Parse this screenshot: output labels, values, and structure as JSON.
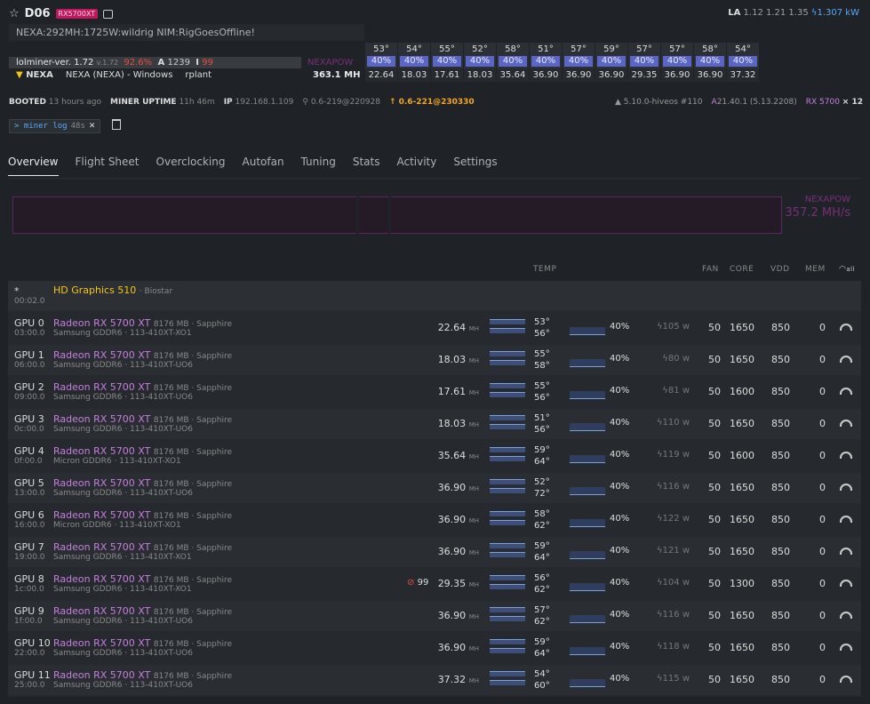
{
  "rig": {
    "name": "D06",
    "badge": "RX5700XT"
  },
  "load_average": {
    "label": "LA",
    "values": "1.12 1.21 1.35",
    "power": "1.307 kW"
  },
  "miner_message": "NEXA:292MH:1725W:wildrig NIM:RigGoesOffline!",
  "miner": {
    "name": "lolminer-ver. 1.72",
    "version": "v.1.72",
    "accept_pct": "92.6%",
    "accepted_label": "A",
    "accepted": "1239",
    "rejected_label": "I",
    "rejected": "99"
  },
  "coin": {
    "symbol": "NEXA",
    "wallet": "NEXA (NEXA) - Windows",
    "pool": "rplant"
  },
  "algo": "NEXAPOW",
  "hashrate": "363.1 MH",
  "gpu_tiles": [
    {
      "temp": "53°",
      "fan": "40%",
      "hr": "22.64"
    },
    {
      "temp": "54°",
      "fan": "40%",
      "hr": "18.03"
    },
    {
      "temp": "55°",
      "fan": "40%",
      "hr": "17.61"
    },
    {
      "temp": "52°",
      "fan": "40%",
      "hr": "18.03"
    },
    {
      "temp": "58°",
      "fan": "40%",
      "hr": "35.64"
    },
    {
      "temp": "51°",
      "fan": "40%",
      "hr": "36.90"
    },
    {
      "temp": "57°",
      "fan": "40%",
      "hr": "36.90"
    },
    {
      "temp": "59°",
      "fan": "40%",
      "hr": "36.90"
    },
    {
      "temp": "57°",
      "fan": "40%",
      "hr": "29.35"
    },
    {
      "temp": "57°",
      "fan": "40%",
      "hr": "36.90"
    },
    {
      "temp": "58°",
      "fan": "40%",
      "hr": "36.90"
    },
    {
      "temp": "54°",
      "fan": "40%",
      "hr": "37.32"
    }
  ],
  "info": {
    "booted_label": "BOOTED",
    "booted": "13 hours ago",
    "uptime_label": "MINER UPTIME",
    "uptime": "11h 46m",
    "ip_label": "IP",
    "ip": "192.168.1.109",
    "agent": "0.6-219@220928",
    "update": "0.6-221@230330",
    "kernel": "5.10.0-hiveos #110",
    "driver": "21.40.1 (5.13.2208)",
    "gpu_model": "RX 5700",
    "gpu_count": "× 12"
  },
  "log_button": {
    "label": "> miner log",
    "age": "48s"
  },
  "tabs": [
    "Overview",
    "Flight Sheet",
    "Overclocking",
    "Autofan",
    "Tuning",
    "Stats",
    "Activity",
    "Settings"
  ],
  "graph": {
    "algo": "NEXAPOW",
    "hashrate": "357.2 MH/s"
  },
  "table_headers": {
    "temp": "TEMP",
    "fan": "FAN",
    "core": "CORE",
    "vdd": "VDD",
    "mem": "MEM",
    "all": "all"
  },
  "cpu": {
    "id": "*",
    "bus": "00:02.0",
    "name": "HD Graphics 510",
    "vendor": "· Biostar"
  },
  "gpus": [
    {
      "id": "GPU 0",
      "bus": "03:00.0",
      "name": "Radeon RX 5700 XT",
      "sub": "8176 MB · Sapphire",
      "mem": "Samsung GDDR6 · 113-410XT-XO1",
      "hr": "22.64",
      "t1": "53°",
      "t2": "56°",
      "fan": "40%",
      "pw": "105",
      "fanv": "50",
      "core": "1650",
      "vdd": "850",
      "memv": "0",
      "rej": ""
    },
    {
      "id": "GPU 1",
      "bus": "06:00.0",
      "name": "Radeon RX 5700 XT",
      "sub": "8176 MB · Sapphire",
      "mem": "Samsung GDDR6 · 113-410XT-UO6",
      "hr": "18.03",
      "t1": "55°",
      "t2": "58°",
      "fan": "40%",
      "pw": "80",
      "fanv": "50",
      "core": "1650",
      "vdd": "850",
      "memv": "0",
      "rej": ""
    },
    {
      "id": "GPU 2",
      "bus": "09:00.0",
      "name": "Radeon RX 5700 XT",
      "sub": "8176 MB · Sapphire",
      "mem": "Samsung GDDR6 · 113-410XT-UO6",
      "hr": "17.61",
      "t1": "55°",
      "t2": "56°",
      "fan": "40%",
      "pw": "81",
      "fanv": "50",
      "core": "1600",
      "vdd": "850",
      "memv": "0",
      "rej": ""
    },
    {
      "id": "GPU 3",
      "bus": "0c:00.0",
      "name": "Radeon RX 5700 XT",
      "sub": "8176 MB · Sapphire",
      "mem": "Samsung GDDR6 · 113-410XT-UO6",
      "hr": "18.03",
      "t1": "51°",
      "t2": "56°",
      "fan": "40%",
      "pw": "110",
      "fanv": "50",
      "core": "1650",
      "vdd": "850",
      "memv": "0",
      "rej": ""
    },
    {
      "id": "GPU 4",
      "bus": "0f:00.0",
      "name": "Radeon RX 5700 XT",
      "sub": "8176 MB · Sapphire",
      "mem": "Micron GDDR6 · 113-410XT-XO1",
      "hr": "35.64",
      "t1": "59°",
      "t2": "64°",
      "fan": "40%",
      "pw": "119",
      "fanv": "50",
      "core": "1600",
      "vdd": "850",
      "memv": "0",
      "rej": ""
    },
    {
      "id": "GPU 5",
      "bus": "13:00.0",
      "name": "Radeon RX 5700 XT",
      "sub": "8176 MB · Sapphire",
      "mem": "Samsung GDDR6 · 113-410XT-UO6",
      "hr": "36.90",
      "t1": "52°",
      "t2": "72°",
      "fan": "40%",
      "pw": "116",
      "fanv": "50",
      "core": "1650",
      "vdd": "850",
      "memv": "0",
      "rej": ""
    },
    {
      "id": "GPU 6",
      "bus": "16:00.0",
      "name": "Radeon RX 5700 XT",
      "sub": "8176 MB · Sapphire",
      "mem": "Micron GDDR6 · 113-410XT-XO1",
      "hr": "36.90",
      "t1": "58°",
      "t2": "62°",
      "fan": "40%",
      "pw": "122",
      "fanv": "50",
      "core": "1650",
      "vdd": "850",
      "memv": "0",
      "rej": ""
    },
    {
      "id": "GPU 7",
      "bus": "19:00.0",
      "name": "Radeon RX 5700 XT",
      "sub": "8176 MB · Sapphire",
      "mem": "Samsung GDDR6 · 113-410XT-XO1",
      "hr": "36.90",
      "t1": "59°",
      "t2": "64°",
      "fan": "40%",
      "pw": "121",
      "fanv": "50",
      "core": "1650",
      "vdd": "850",
      "memv": "0",
      "rej": ""
    },
    {
      "id": "GPU 8",
      "bus": "1c:00.0",
      "name": "Radeon RX 5700 XT",
      "sub": "8176 MB · Sapphire",
      "mem": "Samsung GDDR6 · 113-410XT-XO1",
      "hr": "29.35",
      "t1": "56°",
      "t2": "62°",
      "fan": "40%",
      "pw": "104",
      "fanv": "50",
      "core": "1300",
      "vdd": "850",
      "memv": "0",
      "rej": "99"
    },
    {
      "id": "GPU 9",
      "bus": "1f:00.0",
      "name": "Radeon RX 5700 XT",
      "sub": "8176 MB · Sapphire",
      "mem": "Samsung GDDR6 · 113-410XT-UO6",
      "hr": "36.90",
      "t1": "57°",
      "t2": "62°",
      "fan": "40%",
      "pw": "116",
      "fanv": "50",
      "core": "1650",
      "vdd": "850",
      "memv": "0",
      "rej": ""
    },
    {
      "id": "GPU 10",
      "bus": "22:00.0",
      "name": "Radeon RX 5700 XT",
      "sub": "8176 MB · Sapphire",
      "mem": "Samsung GDDR6 · 113-410XT-UO6",
      "hr": "36.90",
      "t1": "59°",
      "t2": "64°",
      "fan": "40%",
      "pw": "118",
      "fanv": "50",
      "core": "1650",
      "vdd": "850",
      "memv": "0",
      "rej": ""
    },
    {
      "id": "GPU 11",
      "bus": "25:00.0",
      "name": "Radeon RX 5700 XT",
      "sub": "8176 MB · Sapphire",
      "mem": "Samsung GDDR6 · 113-410XT-UO6",
      "hr": "37.32",
      "t1": "54°",
      "t2": "60°",
      "fan": "40%",
      "pw": "115",
      "fanv": "50",
      "core": "1650",
      "vdd": "850",
      "memv": "0",
      "rej": ""
    }
  ]
}
